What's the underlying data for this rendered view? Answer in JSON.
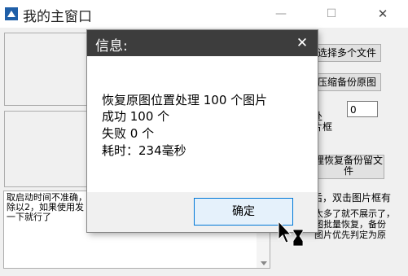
{
  "window": {
    "title": "我的主窗口",
    "minimize_glyph": "—",
    "maximize_glyph": "☐",
    "close_glyph": "✕",
    "icon": "app-icon"
  },
  "main": {
    "buttons": {
      "select_multiple": "选择多个文件",
      "compress_backup": "压缩备份原图",
      "restore_backup_line1": "理恢复备份留文",
      "restore_backup_line2": "件"
    },
    "side_label_1": "处",
    "side_label_2": "片框",
    "count_input_value": "0",
    "tip_label_1": "后，双击图片框有",
    "tip_label_2": "太多了就不展示了，\n图批量恢复，备份\n图片优先判定为原",
    "log_text": "取启动时间不准确，\n除以2，如果使用发\n一下就行了"
  },
  "dialog": {
    "title": "信息:",
    "close_glyph": "✕",
    "messages": [
      "恢复原图位置处理 100 个图片",
      "成功 100 个",
      "失败 0 个",
      "耗时：234毫秒"
    ],
    "ok_label": "确定"
  },
  "colors": {
    "dialog_header": "#3d3d3d",
    "ok_border": "#0078d7",
    "ok_background": "#e5f1fb",
    "app_icon": "#1f5fa8"
  }
}
